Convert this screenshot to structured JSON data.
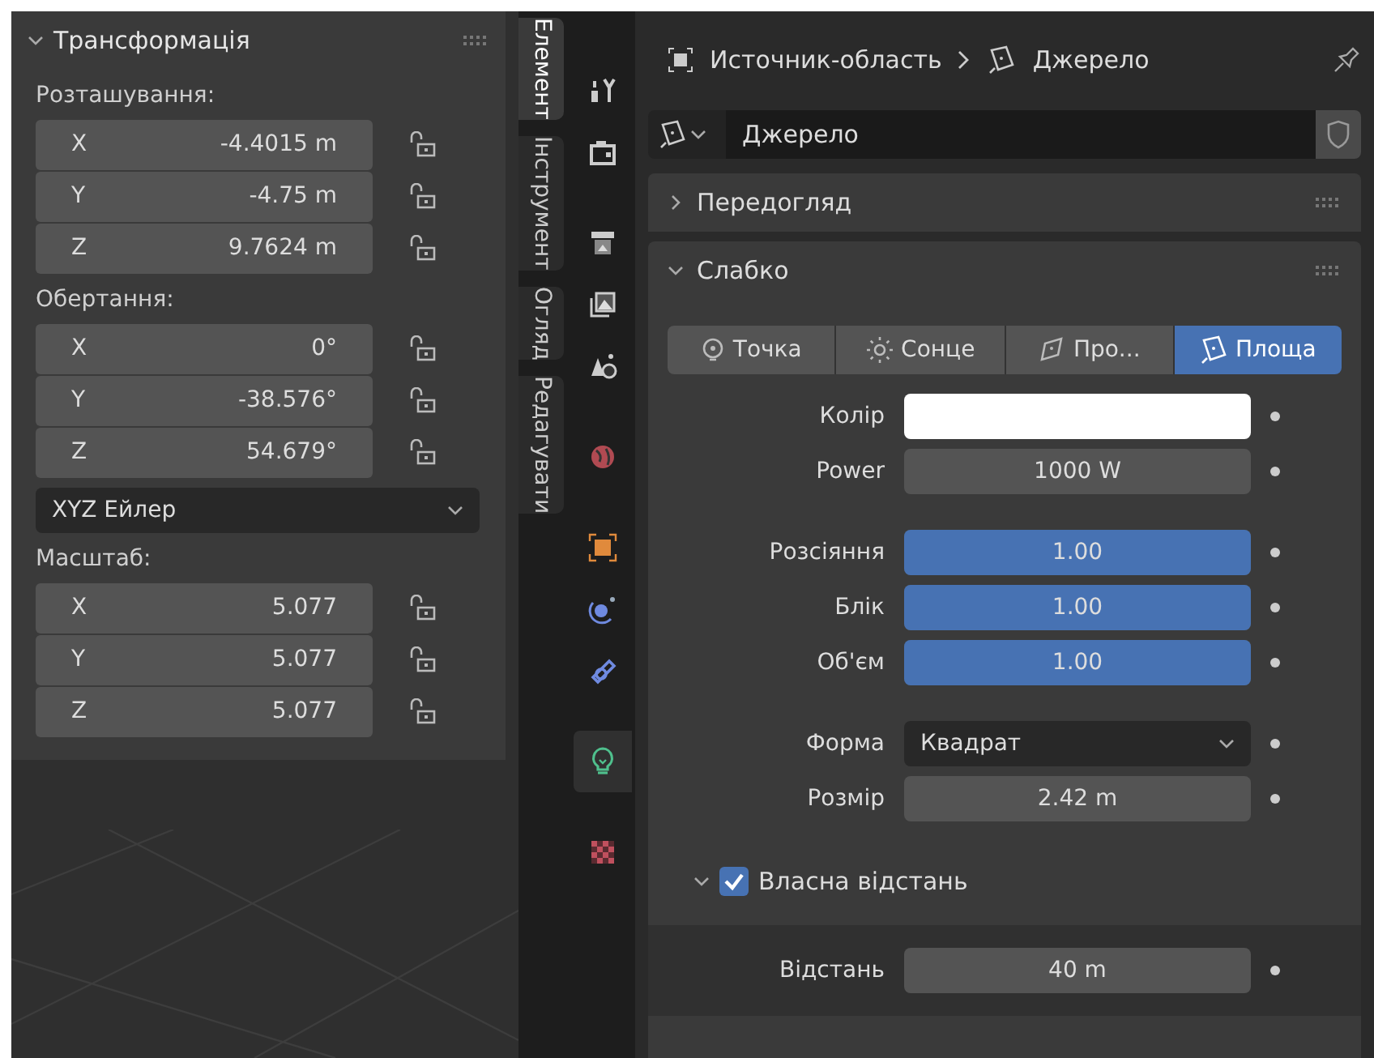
{
  "transform": {
    "title": "Трансформація",
    "expanded": true,
    "groups": [
      {
        "label": "Розташування:",
        "rows": [
          {
            "axis": "X",
            "value": "-4.4015 m"
          },
          {
            "axis": "Y",
            "value": "-4.75 m"
          },
          {
            "axis": "Z",
            "value": "9.7624 m"
          }
        ]
      },
      {
        "label": "Обертання:",
        "rows": [
          {
            "axis": "X",
            "value": "0°"
          },
          {
            "axis": "Y",
            "value": "-38.576°"
          },
          {
            "axis": "Z",
            "value": "54.679°"
          }
        ],
        "mode": "XYZ Ейлер"
      },
      {
        "label": "Масштаб:",
        "rows": [
          {
            "axis": "X",
            "value": "5.077"
          },
          {
            "axis": "Y",
            "value": "5.077"
          },
          {
            "axis": "Z",
            "value": "5.077"
          }
        ]
      }
    ]
  },
  "side_tabs": [
    {
      "label": "Елемент",
      "selected": true
    },
    {
      "label": "Інструмент",
      "selected": false
    },
    {
      "label": "Огляд",
      "selected": false
    },
    {
      "label": "Редагувати",
      "selected": false
    }
  ],
  "property_tabs": [
    {
      "kind": "tool",
      "selected": false
    },
    {
      "kind": "render",
      "selected": false
    },
    {
      "kind": "output",
      "selected": false
    },
    {
      "kind": "view_layer",
      "selected": false
    },
    {
      "kind": "scene",
      "selected": false
    },
    {
      "kind": "world",
      "selected": false
    },
    {
      "kind": "object",
      "selected": false
    },
    {
      "kind": "physics",
      "selected": false
    },
    {
      "kind": "constraints",
      "selected": false
    },
    {
      "kind": "light",
      "selected": true
    },
    {
      "kind": "texture",
      "selected": false
    }
  ],
  "breadcrumb": {
    "object": "Источник-область",
    "data": "Джерело"
  },
  "datablock": {
    "value": "Джерело"
  },
  "panels": [
    {
      "title": "Передогляд",
      "expanded": false
    },
    {
      "title": "Слабко",
      "expanded": true
    }
  ],
  "light_types": [
    {
      "kind": "point",
      "label": "Точка",
      "selected": false
    },
    {
      "kind": "sun",
      "label": "Сонце",
      "selected": false
    },
    {
      "kind": "spot",
      "label": "Про...",
      "selected": false
    },
    {
      "kind": "area",
      "label": "Площа",
      "selected": true
    }
  ],
  "fields": [
    {
      "kind": "color",
      "label": "Колір",
      "color": "#ffffff"
    },
    {
      "kind": "number",
      "label": "Power",
      "value": "1000 W"
    },
    {
      "kind": "slider",
      "label": "Розсіяння",
      "value": "1.00",
      "level": 1
    },
    {
      "kind": "slider",
      "label": "Блік",
      "value": "1.00",
      "level": 1
    },
    {
      "kind": "slider",
      "label": "Об'єм",
      "value": "1.00",
      "level": 1
    },
    {
      "kind": "dropdown",
      "label": "Форма",
      "value": "Квадрат"
    },
    {
      "kind": "number",
      "label": "Розмір",
      "value": "2.42 m"
    }
  ],
  "custom_distance": {
    "label": "Власна відстань",
    "checked": true,
    "expanded": true,
    "field": {
      "label": "Відстань",
      "value": "40 m"
    }
  }
}
